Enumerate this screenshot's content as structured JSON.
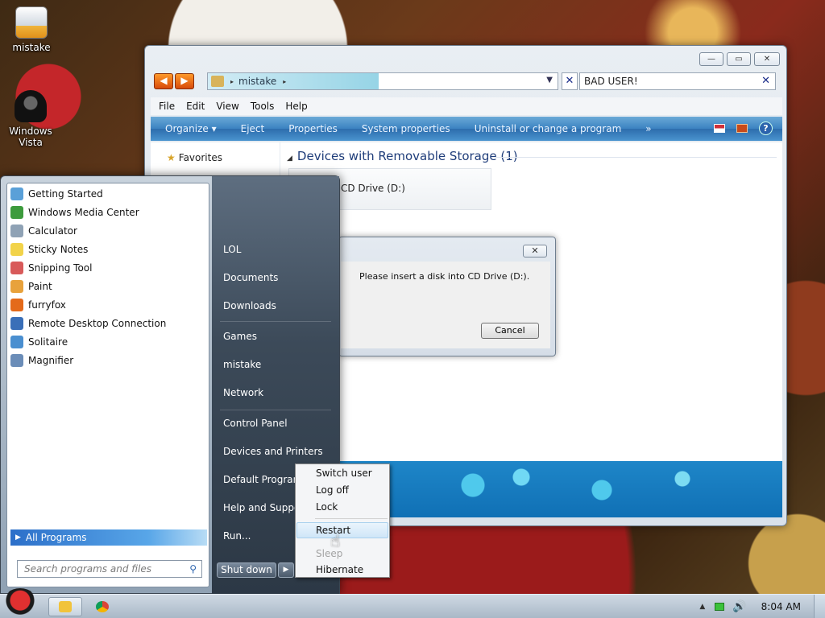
{
  "desktop": {
    "icons": [
      {
        "label": "mistake",
        "icon": "computer-folder-icon"
      },
      {
        "label": "Windows\nVista",
        "icon": "vista-logo-icon"
      }
    ]
  },
  "explorer": {
    "window_controls": {
      "minimize": "—",
      "maximize": "▭",
      "close": "✕"
    },
    "nav": {
      "back": "◀",
      "forward": "▶"
    },
    "address": {
      "crumb_sep": "▸",
      "location": "mistake",
      "trail_sep": "▸",
      "dropdown": "▼"
    },
    "clear_address": "✕",
    "search": {
      "value": "BAD USER!",
      "clear": "✕"
    },
    "menu": [
      "File",
      "Edit",
      "View",
      "Tools",
      "Help"
    ],
    "commands": [
      "Organize ▾",
      "Eject",
      "Properties",
      "System properties",
      "Uninstall or change a program",
      "»"
    ],
    "help_label": "?",
    "nav_pane": {
      "favorites": "Favorites"
    },
    "group_header": "Devices with Removable Storage (1)",
    "group_toggle": "◢",
    "drive_label": "CD Drive (D:)"
  },
  "dialog": {
    "close": "✕",
    "message": "Please insert a disk into CD Drive (D:).",
    "cancel": "Cancel"
  },
  "start_menu": {
    "programs": [
      {
        "label": "Getting Started",
        "color": "#5aa0d8"
      },
      {
        "label": "Windows Media Center",
        "color": "#3d9b3d"
      },
      {
        "label": "Calculator",
        "color": "#8fa2b5"
      },
      {
        "label": "Sticky Notes",
        "color": "#f2d34a"
      },
      {
        "label": "Snipping Tool",
        "color": "#d85a5a"
      },
      {
        "label": "Paint",
        "color": "#e8a23c"
      },
      {
        "label": "furryfox",
        "color": "#e46a1a"
      },
      {
        "label": "Remote Desktop Connection",
        "color": "#3a6fb8"
      },
      {
        "label": "Solitaire",
        "color": "#4a8fd0"
      },
      {
        "label": "Magnifier",
        "color": "#6b8db8"
      }
    ],
    "all_programs": "All Programs",
    "all_programs_arrow": "▶",
    "search_placeholder": "Search programs and files",
    "search_icon": "⚲",
    "right_links": [
      "LOL",
      "Documents",
      "Downloads",
      "Games",
      "mistake",
      "Network",
      "Control Panel",
      "Devices and Printers",
      "Default Programs",
      "Help and Support",
      "Run..."
    ],
    "shutdown": "Shut down",
    "shutdown_arrow": "▶"
  },
  "shutdown_menu": {
    "items": [
      {
        "label": "Switch user",
        "state": "normal"
      },
      {
        "label": "Log off",
        "state": "normal"
      },
      {
        "label": "Lock",
        "state": "normal"
      },
      {
        "label": "Restart",
        "state": "hover"
      },
      {
        "label": "Sleep",
        "state": "disabled"
      },
      {
        "label": "Hibernate",
        "state": "normal"
      }
    ]
  },
  "taskbar": {
    "tray_arrow": "▲",
    "volume_icon": "🔊",
    "clock": "8:04 AM"
  }
}
